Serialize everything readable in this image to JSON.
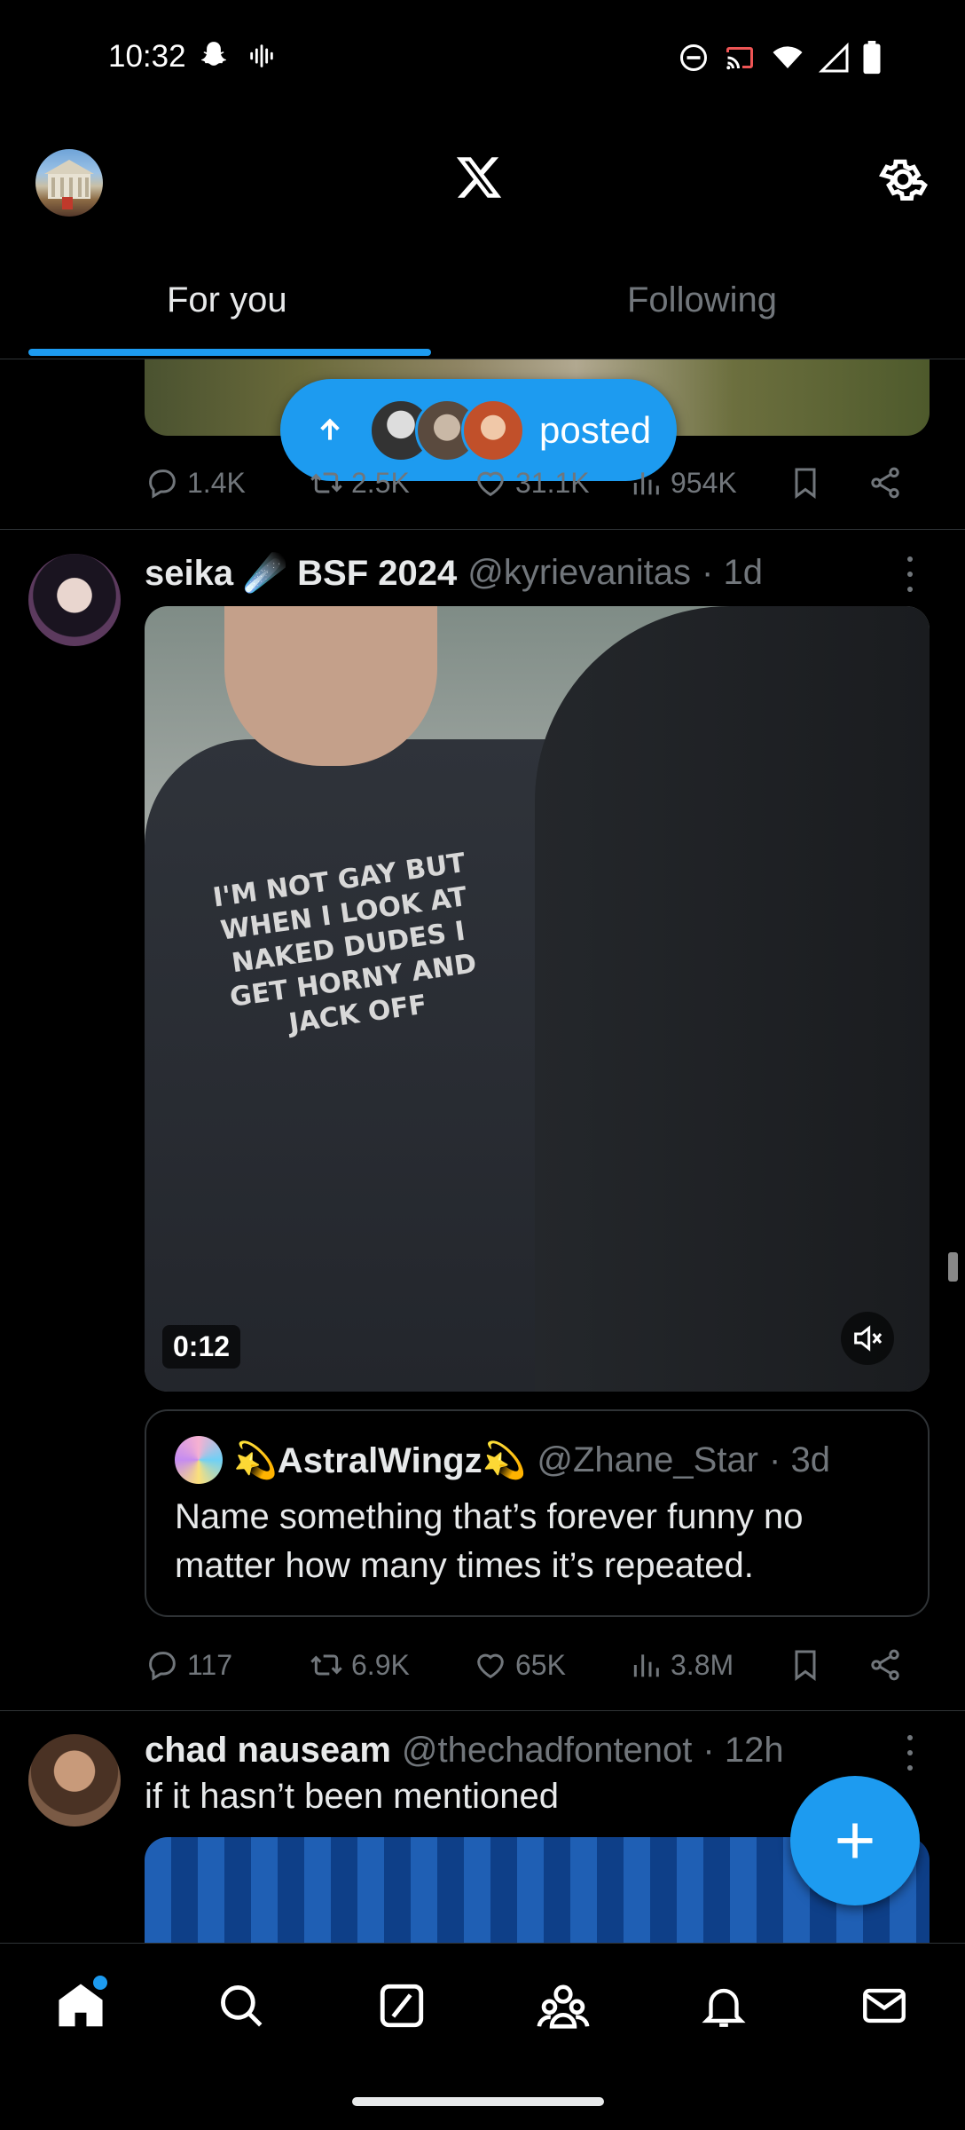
{
  "status_bar": {
    "time": "10:32",
    "left_icons": [
      "snapchat-icon",
      "voice-waveform-icon"
    ],
    "right_icons": [
      "do-not-disturb-icon",
      "cast-icon",
      "wifi-icon",
      "signal-icon",
      "battery-icon"
    ]
  },
  "header": {
    "logo": "x-logo-icon",
    "settings_icon": "gear-icon",
    "tabs": [
      {
        "label": "For you",
        "active": true
      },
      {
        "label": "Following",
        "active": false
      }
    ]
  },
  "posted_pill": {
    "label": "posted",
    "arrow_icon": "arrow-up-icon"
  },
  "prev_tweet_actions": {
    "replies": "1.4K",
    "reposts": "2.5K",
    "likes": "31.1K",
    "views": "954K"
  },
  "tweet1": {
    "name": "seika ☄️ BSF 2024",
    "handle": "@kyrievanitas",
    "time": "· 1d",
    "video": {
      "duration": "0:12",
      "shirt_text": "I'M NOT GAY BUT WHEN I LOOK AT NAKED DUDES I GET HORNY AND JACK OFF"
    },
    "quote": {
      "name": "💫AstralWingz💫",
      "handle": "@Zhane_Star",
      "time": "· 3d",
      "text": "Name something that’s forever funny no matter how many times it’s repeated."
    },
    "actions": {
      "replies": "117",
      "reposts": "6.9K",
      "likes": "65K",
      "views": "3.8M"
    }
  },
  "tweet2": {
    "name": "chad nauseam",
    "handle": "@thechadfontenot",
    "time": "· 12h",
    "text": "if it hasn’t been mentioned"
  },
  "fab_icon": "plus-icon",
  "bottom_nav": [
    "home-icon",
    "search-icon",
    "grok-icon",
    "communities-icon",
    "notifications-icon",
    "messages-icon"
  ],
  "colors": {
    "accent": "#1d9bf0",
    "background": "#000000",
    "text": "#e7e9ea",
    "muted": "#71767b",
    "divider": "#2f3336"
  }
}
